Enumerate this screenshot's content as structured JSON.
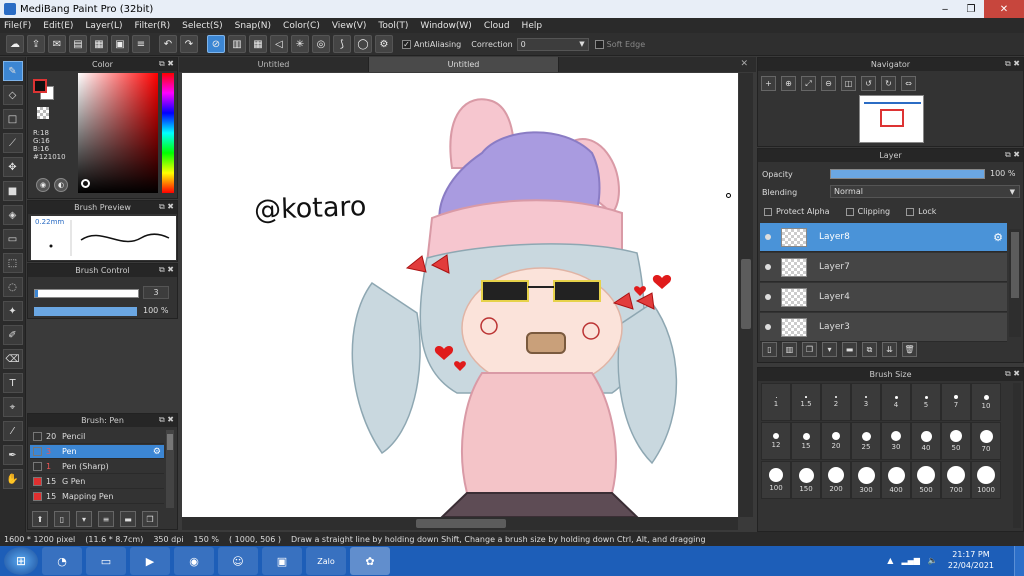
{
  "window": {
    "title": "MediBang Paint Pro (32bit)",
    "minimize": "‒",
    "maximize": "❐",
    "close": "✕"
  },
  "menu": [
    "File(F)",
    "Edit(E)",
    "Layer(L)",
    "Filter(R)",
    "Select(S)",
    "Snap(N)",
    "Color(C)",
    "View(V)",
    "Tool(T)",
    "Window(W)",
    "Cloud",
    "Help"
  ],
  "toolbar": {
    "antialiasing_label": "AntiAliasing",
    "antialiasing_checked": true,
    "correction_label": "Correction",
    "correction_value": "0",
    "soft_edge_label": "Soft Edge",
    "soft_edge_checked": false
  },
  "panels": {
    "color": {
      "title": "Color",
      "r": "R:18",
      "g": "G:16",
      "b": "B:16",
      "hex": "#121010"
    },
    "brush_preview": {
      "title": "Brush Preview",
      "size": "0.22mm"
    },
    "brush_control": {
      "title": "Brush Control",
      "size_value": "3",
      "opacity_value": "100 %"
    },
    "brush_list": {
      "title": "Brush: Pen",
      "items": [
        {
          "size": "20",
          "name": "Pencil",
          "color": "#333333"
        },
        {
          "size": "3",
          "name": "Pen",
          "color": "#3c86d3",
          "selected": true
        },
        {
          "size": "1",
          "name": "Pen (Sharp)",
          "color": "#333333"
        },
        {
          "size": "15",
          "name": "G Pen",
          "color": "#e03030"
        },
        {
          "size": "15",
          "name": "Mapping Pen",
          "color": "#e03030"
        }
      ]
    },
    "navigator": {
      "title": "Navigator"
    },
    "layer": {
      "title": "Layer",
      "opacity_label": "Opacity",
      "opacity_value": "100 %",
      "blending_label": "Blending",
      "blending_value": "Normal",
      "protect_alpha": "Protect Alpha",
      "clipping": "Clipping",
      "lock": "Lock",
      "layers": [
        "Layer8",
        "Layer7",
        "Layer4",
        "Layer3"
      ]
    },
    "brush_size": {
      "title": "Brush Size",
      "sizes": [
        "1",
        "1.5",
        "2",
        "3",
        "4",
        "5",
        "7",
        "10",
        "12",
        "15",
        "20",
        "25",
        "30",
        "40",
        "50",
        "70",
        "100",
        "150",
        "200",
        "300",
        "400",
        "500",
        "700",
        "1000"
      ]
    }
  },
  "canvas": {
    "tabs": [
      "Untitled",
      "Untitled"
    ],
    "signature_text": "@kotaro"
  },
  "status": {
    "dimensions": "1600 * 1200 pixel",
    "physical": "(11.6 * 8.7cm)",
    "dpi": "350 dpi",
    "zoom": "150 %",
    "coords": "( 1000, 506 )",
    "hint": "Draw a straight line by holding down Shift, Change a brush size by holding down Ctrl, Alt, and dragging"
  },
  "taskbar": {
    "time": "21:17 PM",
    "date": "22/04/2021",
    "zalo_label": "Zalo"
  }
}
